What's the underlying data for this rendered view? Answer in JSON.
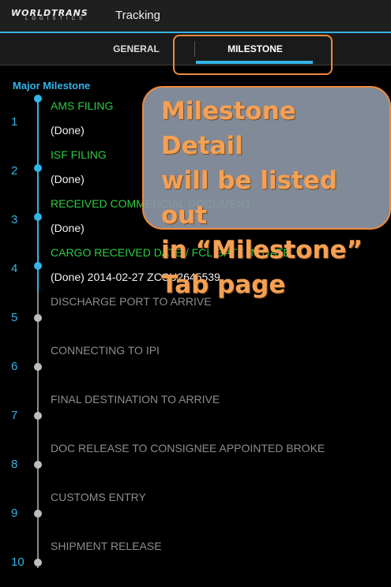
{
  "actionbar": {
    "logo_line1": "WORLDTRANS",
    "logo_line2": "LOGISTICS",
    "title": "Tracking",
    "accent_color": "#33b5e5"
  },
  "tabs": [
    {
      "label": "GENERAL",
      "selected": false
    },
    {
      "label": "MILESTONE",
      "selected": true
    }
  ],
  "section_title": "Major Milestone",
  "milestones": [
    {
      "num": "1",
      "title": "AMS FILING",
      "status": "(Done)",
      "done": true
    },
    {
      "num": "2",
      "title": "ISF FILING",
      "status": "(Done)",
      "done": true
    },
    {
      "num": "3",
      "title": "RECEIVED COMMERCIAL DOCUMENT",
      "status": "(Done)",
      "done": true
    },
    {
      "num": "4",
      "title": "CARGO RECEIVED DATE / FCL GATE IN DATE",
      "status": "(Done) 2014-02-27 ZCSU2645539",
      "done": true
    },
    {
      "num": "5",
      "title": "DISCHARGE PORT TO ARRIVE",
      "status": "",
      "done": false
    },
    {
      "num": "6",
      "title": "CONNECTING TO IPI",
      "status": "",
      "done": false
    },
    {
      "num": "7",
      "title": "FINAL DESTINATION TO ARRIVE",
      "status": "",
      "done": false
    },
    {
      "num": "8",
      "title": "DOC RELEASE TO CONSIGNEE APPOINTED BROKE",
      "status": "",
      "done": false
    },
    {
      "num": "9",
      "title": "CUSTOMS ENTRY",
      "status": "",
      "done": false
    },
    {
      "num": "10",
      "title": "SHIPMENT RELEASE",
      "status": "",
      "done": false
    }
  ],
  "callout": {
    "lines": [
      "Milestone Detail",
      "will be listed out",
      "in “Milestone”",
      "Tab page"
    ],
    "color": "#f5a054"
  }
}
